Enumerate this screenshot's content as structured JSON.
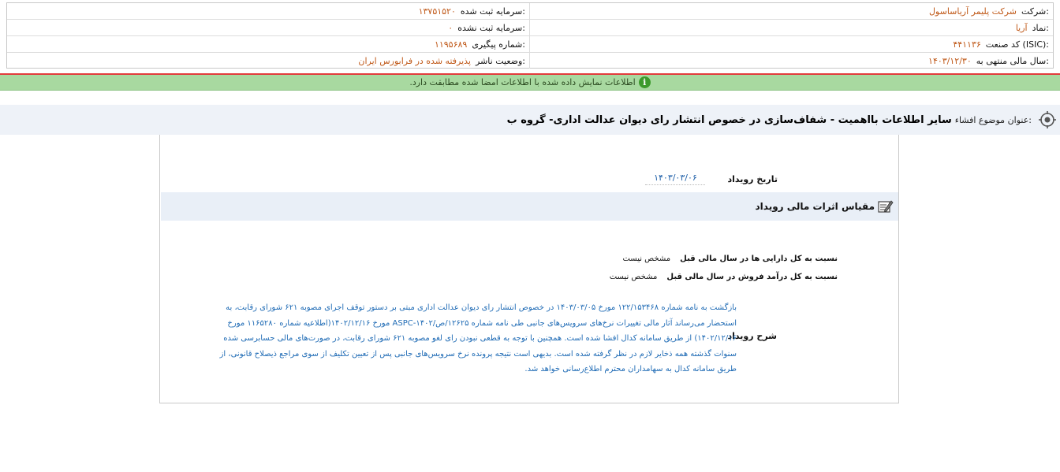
{
  "header": {
    "rows": [
      {
        "right_label": "شرکت:",
        "right_value": "شرکت پلیمر آریاساسول",
        "left_label": "سرمایه ثبت شده:",
        "left_value": "۱۳۷۵۱۵۲۰"
      },
      {
        "right_label": "نماد:",
        "right_value": "آریا",
        "left_label": "سرمایه ثبت نشده:",
        "left_value": "۰"
      },
      {
        "right_label": "کد صنعت (ISIC):",
        "right_value": "۴۴۱۱۳۶",
        "left_label": "شماره پیگیری:",
        "left_value": "۱۱۹۵۶۸۹"
      },
      {
        "right_label": "سال مالی منتهی به:",
        "right_value": "۱۴۰۳/۱۲/۳۰",
        "left_label": "وضعیت ناشر:",
        "left_value": "پذیرفته شده در فرابورس ایران"
      }
    ]
  },
  "banner": {
    "text": "اطلاعات نمایش داده شده با اطلاعات امضا شده مطابقت دارد.",
    "icon": "i",
    "color": "#a8d9a0"
  },
  "subject": {
    "label": "عنوان موضوع افشاء:",
    "value": "سایر اطلاعات بااهمیت - شفاف‌سازی در خصوص انتشار رای دیوان عدالت اداری- گروه ب"
  },
  "event": {
    "date_label": "تاریخ رویداد",
    "date_value": "۱۴۰۳/۰۳/۰۶"
  },
  "section": {
    "title": "مقیاس اثرات مالی رویداد"
  },
  "ratios": [
    {
      "label": "نسبت به کل دارایی ها در سال مالی قبل",
      "value": "مشخص نیست"
    },
    {
      "label": "نسبت به کل درآمد فروش در سال مالی قبل",
      "value": "مشخص نیست"
    }
  ],
  "description": {
    "label": "شرح رویداد",
    "text": "بازگشت به نامه شماره ۱۲۲/۱۵۳۴۶۸ مورخ ۱۴۰۳/۰۳/۰۵ در خصوص انتشار رای دیوان عدالت اداری مبتی بر دستور توقف اجرای مصوبه ۶۲۱ شورای رقابت، به استحضار می‌رساند آثار مالی تغییرات نرخ‌های سرویس‌های جانبی طی نامه شماره ۱۲۶۲۵/ص/۱۴۰۲-ASPC مورخ ۱۴۰۲/۱۲/۱۶(اطلاعیه شماره ۱۱۶۵۲۸۰ مورخ ۱۴۰۲/۱۲/۱۶) از طریق سامانه کدال افشا شده است. همچنین با توجه به قطعی نبودن رای لغو مصوبه ۶۲۱ شورای رقابت، در صورت‌های مالی حسابرسی شده سنوات گذشته همه ذخایر لازم در نظر گرفته شده است. بدیهی است نتیجه پرونده نرخ سرویس‌های جانبی پس از تعیین تکلیف از سوی مراجع ذیصلاح قانونی، از طریق سامانه کدال به سهامداران محترم اطلاع‌رسانی خواهد شد."
  }
}
